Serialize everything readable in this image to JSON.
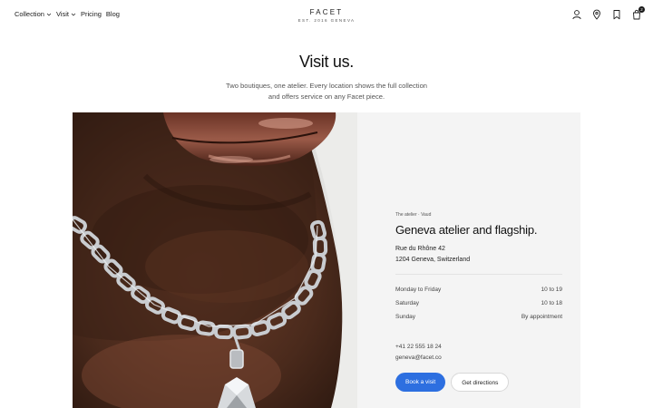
{
  "nav": {
    "links": [
      {
        "label": "Collection",
        "has_dropdown": true
      },
      {
        "label": "Visit",
        "has_dropdown": true
      },
      {
        "label": "Pricing",
        "has_dropdown": false
      },
      {
        "label": "Blog",
        "has_dropdown": false
      }
    ],
    "brand": {
      "name": "FACET",
      "tagline": "EST. 2016 GENEVA"
    },
    "icons": [
      "account-icon",
      "location-pin-icon",
      "bookmark-icon",
      "shopping-bag-icon"
    ],
    "cart_count": "2"
  },
  "hero": {
    "title": "Visit us.",
    "subtitle": "Two boutiques, one atelier. Every location shows the full collection and offers service on any Facet piece."
  },
  "location": {
    "eyebrow": "The atelier · Vaud",
    "title": "Geneva atelier and flagship.",
    "address_line1": "Rue du Rhône 42",
    "address_line2": "1204 Geneva, Switzerland",
    "hours": [
      {
        "day": "Monday to Friday",
        "time": "10 to 19"
      },
      {
        "day": "Saturday",
        "time": "10 to 18"
      },
      {
        "day": "Sunday",
        "time": "By appointment"
      }
    ],
    "phone": "+41 22 555 18 24",
    "email": "geneva@facet.co",
    "primary_action": "Book a visit",
    "secondary_action": "Get directions"
  },
  "colors": {
    "accent": "#2d6fe0",
    "panel": "#f4f4f4",
    "text": "#1a1a1a"
  }
}
